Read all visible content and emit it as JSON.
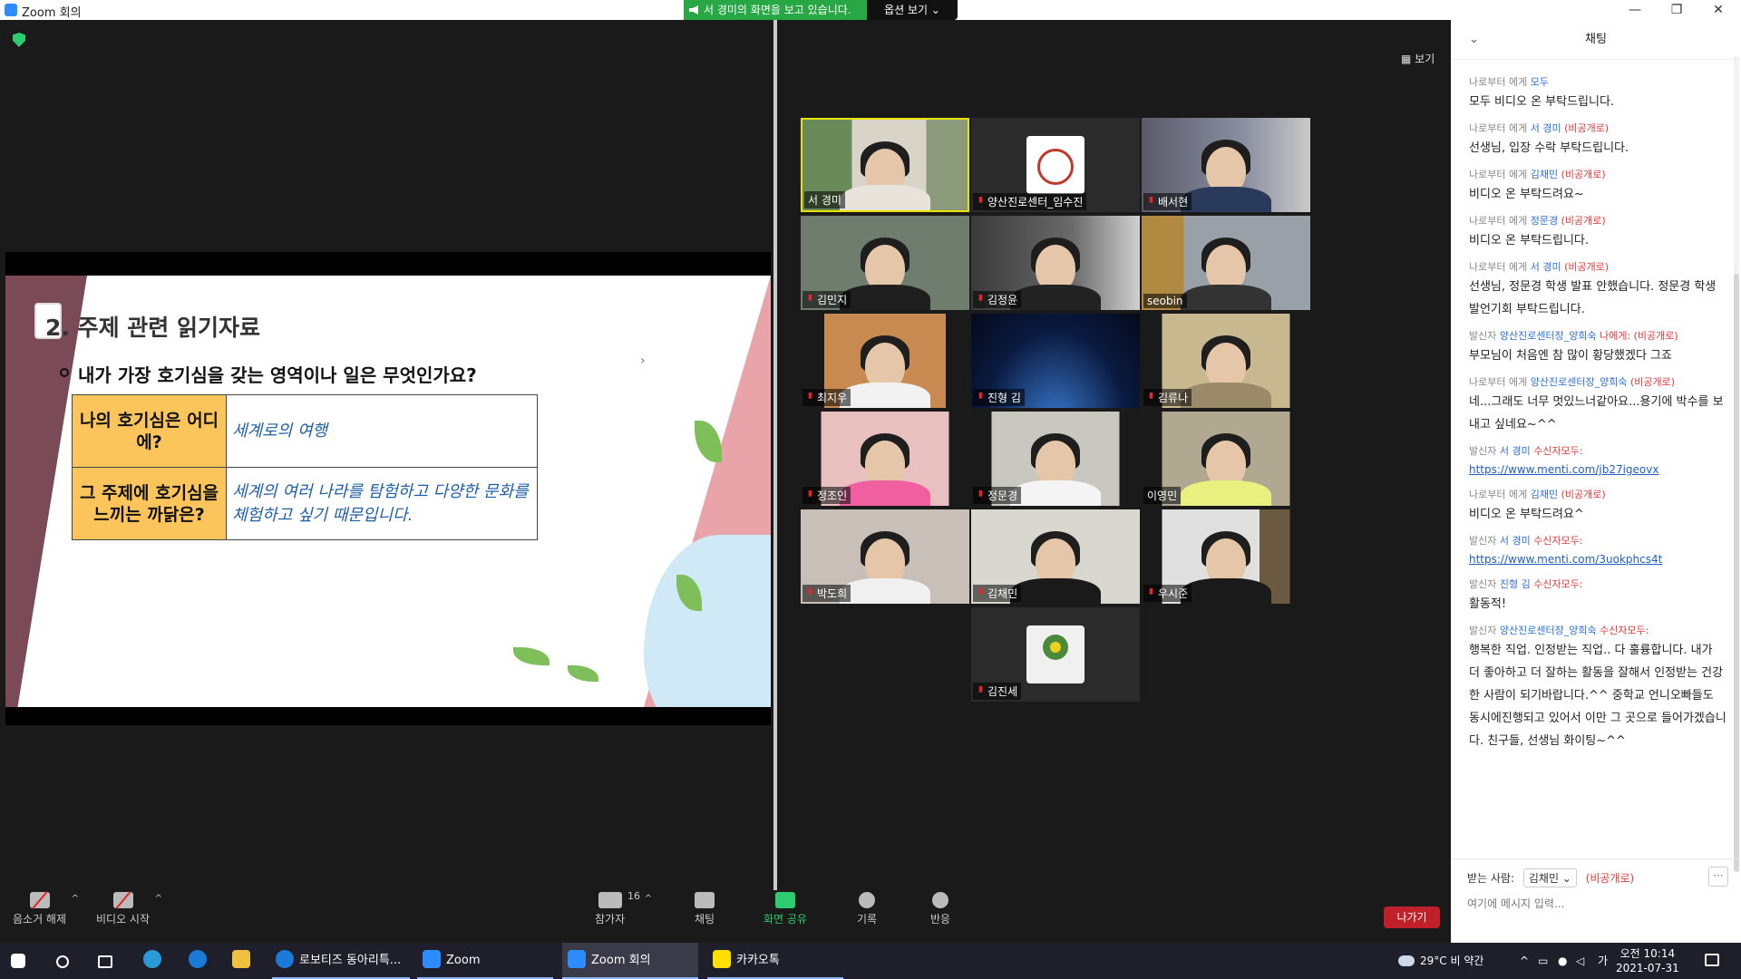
{
  "window": {
    "title": "Zoom 회의",
    "minimize": "—",
    "maximize": "❐",
    "close": "✕"
  },
  "share_banner": {
    "text": "서 경미의 화면을 보고 있습니다.",
    "options_label": "옵션 보기 ⌄"
  },
  "view_button": {
    "label": "보기"
  },
  "slide": {
    "title": "2. 주제 관련 읽기자료",
    "question": "내가 가장 호기심을 갖는 영역이나 일은 무엇인가요?",
    "rows": [
      {
        "label": "나의 호기심은 어디에?",
        "value": "세계로의 여행"
      },
      {
        "label": "그 주제에 호기심을 느끼는 까닭은?",
        "value": "세계의 여러 나라를 탐험하고 다양한 문화를 체험하고 싶기 때문입니다."
      }
    ]
  },
  "participants": [
    {
      "name": "서 경미",
      "muted": false
    },
    {
      "name": "양산진로센터_임수진",
      "muted": true
    },
    {
      "name": "배서현",
      "muted": true
    },
    {
      "name": "김민지",
      "muted": true
    },
    {
      "name": "김정윤",
      "muted": true
    },
    {
      "name": "seobin",
      "muted": false
    },
    {
      "name": "최지우",
      "muted": true
    },
    {
      "name": "진형 김",
      "muted": true
    },
    {
      "name": "김류나",
      "muted": true
    },
    {
      "name": "정조인",
      "muted": true
    },
    {
      "name": "정문경",
      "muted": true
    },
    {
      "name": "이영민",
      "muted": false
    },
    {
      "name": "박도희",
      "muted": true
    },
    {
      "name": "김채민",
      "muted": true
    },
    {
      "name": "우시준",
      "muted": true
    },
    {
      "name": "김진세",
      "muted": true
    }
  ],
  "toolbar": {
    "unmute": "음소거 해제",
    "start_video": "비디오 시작",
    "participants": "참가자",
    "participants_count": "16",
    "chat": "채팅",
    "share_screen": "화면 공유",
    "record": "기록",
    "reactions": "반응",
    "leave": "나가기"
  },
  "chat": {
    "header": "채팅",
    "messages": [
      {
        "from": "나로부터",
        "to_prefix": "에게",
        "to": "모두",
        "private": "",
        "text": "모두 비디오 온 부탁드립니다.",
        "link": ""
      },
      {
        "from": "나로부터",
        "to_prefix": "에게",
        "to": "서 경미",
        "private": "(비공개로)",
        "text": "선생님, 입장 수락 부탁드립니다.",
        "link": ""
      },
      {
        "from": "나로부터",
        "to_prefix": "에게",
        "to": "김채민",
        "private": "(비공개로)",
        "text": "비디오 온 부탁드려요~",
        "link": ""
      },
      {
        "from": "나로부터",
        "to_prefix": "에게",
        "to": "정문경",
        "private": "(비공개로)",
        "text": "비디오 온 부탁드립니다.",
        "link": ""
      },
      {
        "from": "나로부터",
        "to_prefix": "에게",
        "to": "서 경미",
        "private": "(비공개로)",
        "text": "선생님, 정문경 학생 발표 안했습니다. 정문경 학생 발언기회 부탁드립니다.",
        "link": ""
      },
      {
        "from": "발신자",
        "to_prefix": "",
        "to": "양산진로센터장_양희숙",
        "private": "나에게: (비공개로)",
        "text": "부모님이 처음엔 참 많이 황당했겠다 그죠",
        "link": ""
      },
      {
        "from": "나로부터",
        "to_prefix": "에게",
        "to": "양산진로센터장_양희숙",
        "private": "(비공개로)",
        "text": "네...그래도 너무 멋있느너같아요...용기에 박수를 보내고 싶네요~^^",
        "link": ""
      },
      {
        "from": "발신자",
        "to_prefix": "",
        "to": "서 경미",
        "private": "수신자모두:",
        "text": "",
        "link": "https://www.menti.com/jb27igeovx"
      },
      {
        "from": "나로부터",
        "to_prefix": "에게",
        "to": "김채민",
        "private": "(비공개로)",
        "text": "비디오 온 부탁드려요^",
        "link": ""
      },
      {
        "from": "발신자",
        "to_prefix": "",
        "to": "서 경미",
        "private": "수신자모두:",
        "text": "",
        "link": "https://www.menti.com/3uokphcs4t"
      },
      {
        "from": "발신자",
        "to_prefix": "",
        "to": "진형 김",
        "private": "수신자모두:",
        "text": "활동적!",
        "link": ""
      },
      {
        "from": "발신자",
        "to_prefix": "",
        "to": "양산진로센터장_양희숙",
        "private": "수신자모두:",
        "text": "행복한 직업. 인정받는 직업.. 다 훌륭합니다. 내가 더 좋아하고 더 잘하는 활동을 잘해서 인정받는 건강한 사람이 되기바랍니다.^^ 중학교 언니오빠들도 동시에진행되고 있어서 이만 그 곳으로 들어가겠습니다. 친구들, 선생님 화이팅~^^",
        "link": ""
      }
    ],
    "recipient_label": "받는 사람:",
    "recipient": "김채민 ⌄",
    "recipient_private": "(비공개로)",
    "input_placeholder": "여기에 메시지 입력..."
  },
  "taskbar": {
    "apps": [
      "로보티즈 동아리특...",
      "Zoom",
      "Zoom 회의",
      "카카오톡"
    ],
    "weather": "29°C 비 약간",
    "ime": "가",
    "time": "오전 10:14",
    "date": "2021-07-31"
  }
}
